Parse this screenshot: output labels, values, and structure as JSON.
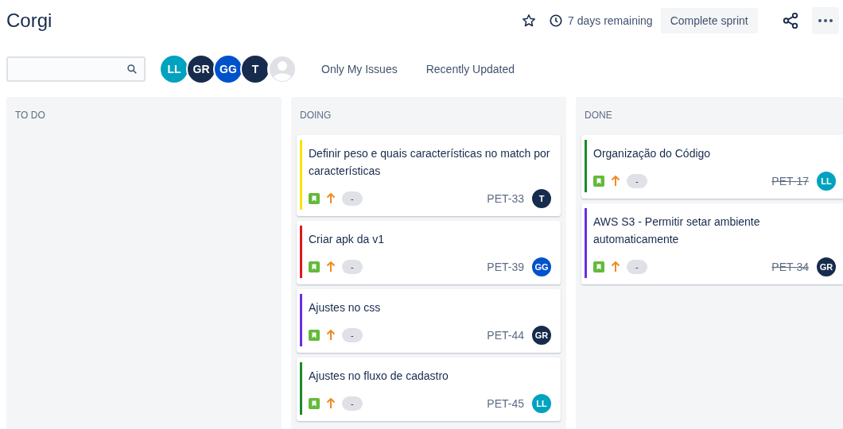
{
  "title": "Corgi",
  "header": {
    "starred": false,
    "remaining": "7 days remaining",
    "complete_button": "Complete sprint"
  },
  "avatars": [
    {
      "initials": "LL",
      "color": "#00a3bf"
    },
    {
      "initials": "GR",
      "color": "#172b4d"
    },
    {
      "initials": "GG",
      "color": "#0052cc"
    },
    {
      "initials": "T",
      "color": "#172b4d"
    },
    {
      "kind": "placeholder"
    }
  ],
  "filters": [
    {
      "label": "Only My Issues",
      "selected": false
    },
    {
      "label": "Recently Updated",
      "selected": false
    }
  ],
  "columns": [
    {
      "name": "TO DO"
    },
    {
      "name": "DOING",
      "cards": [
        {
          "summary": "Definir peso e quais características no match por características",
          "color": "#f5e500",
          "estimate": "-",
          "key": "PET-33",
          "done": false,
          "assignee": {
            "initials": "T",
            "color": "#172b4d"
          }
        },
        {
          "summary": "Criar apk da v1",
          "color": "#de1a1a",
          "estimate": "-",
          "key": "PET-39",
          "done": false,
          "assignee": {
            "initials": "GG",
            "color": "#0052cc"
          }
        },
        {
          "summary": "Ajustes no css",
          "color": "#6c2ee6",
          "estimate": "-",
          "key": "PET-44",
          "done": false,
          "assignee": {
            "initials": "GR",
            "color": "#172b4d"
          }
        },
        {
          "summary": "Ajustes no fluxo de cadastro",
          "color": "#1a8a2a",
          "estimate": "-",
          "key": "PET-45",
          "done": false,
          "assignee": {
            "initials": "LL",
            "color": "#00a3bf"
          }
        }
      ]
    },
    {
      "name": "DONE",
      "cards": [
        {
          "summary": "Organização do Código",
          "color": "#1a8a2a",
          "estimate": "-",
          "key": "PET-17",
          "done": true,
          "assignee": {
            "initials": "LL",
            "color": "#00a3bf"
          }
        },
        {
          "summary": "AWS S3 - Permitir setar ambiente automaticamente",
          "color": "#6c2ee6",
          "estimate": "-",
          "key": "PET-34",
          "done": true,
          "assignee": {
            "initials": "GR",
            "color": "#172b4d"
          }
        }
      ]
    }
  ]
}
